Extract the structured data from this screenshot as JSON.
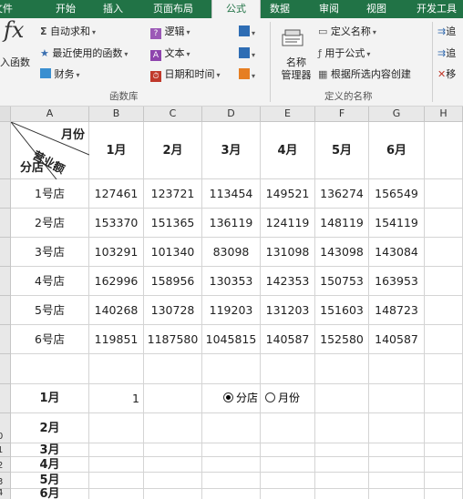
{
  "tabs": [
    {
      "label": "文件",
      "active": false
    },
    {
      "label": "开始",
      "active": false
    },
    {
      "label": "插入",
      "active": false
    },
    {
      "label": "页面布局",
      "active": false
    },
    {
      "label": "公式",
      "active": true
    },
    {
      "label": "数据",
      "active": false
    },
    {
      "label": "审阅",
      "active": false
    },
    {
      "label": "视图",
      "active": false
    },
    {
      "label": "开发工具",
      "active": false
    }
  ],
  "ribbon": {
    "insert_fn": "入函数",
    "fx": "fx",
    "autosum": "自动求和",
    "recent": "最近使用的函数",
    "finance": "财务",
    "logic": "逻辑",
    "text": "文本",
    "datetime": "日期和时间",
    "group_lib": "函数库",
    "name_mgr_1": "名称",
    "name_mgr_2": "管理器",
    "define_name": "定义名称",
    "use_in_formula": "用于公式",
    "create_from_sel": "根据所选内容创建",
    "group_names": "定义的名称",
    "right1": "追",
    "right2": "追",
    "right3": "移"
  },
  "columns": [
    "A",
    "B",
    "C",
    "D",
    "E",
    "F",
    "G",
    "H"
  ],
  "header_cell": {
    "top": "月份",
    "mid": "营业额",
    "bottom": "分店"
  },
  "months": [
    "1月",
    "2月",
    "3月",
    "4月",
    "5月",
    "6月"
  ],
  "stores": [
    {
      "name": "1号店",
      "values": [
        "127461",
        "123721",
        "113454",
        "149521",
        "136274",
        "156549"
      ]
    },
    {
      "name": "2号店",
      "values": [
        "153370",
        "151365",
        "136119",
        "124119",
        "148119",
        "154119"
      ]
    },
    {
      "name": "3号店",
      "values": [
        "103291",
        "101340",
        "83098",
        "131098",
        "143098",
        "143084"
      ]
    },
    {
      "name": "4号店",
      "values": [
        "162996",
        "158956",
        "130353",
        "142353",
        "150753",
        "163953"
      ]
    },
    {
      "name": "5号店",
      "values": [
        "140268",
        "130728",
        "119203",
        "131203",
        "151603",
        "148723"
      ]
    },
    {
      "name": "6号店",
      "values": [
        "119851",
        "1187580",
        "1045815",
        "140587",
        "152580",
        "140587"
      ]
    }
  ],
  "selector": {
    "value": "1",
    "radio_store": "分店",
    "radio_month": "月份",
    "selected": "store"
  },
  "row_numbers": [
    "",
    "",
    "",
    "",
    "",
    "",
    "",
    "",
    "",
    "0",
    "1",
    "2",
    "3",
    "4",
    ""
  ]
}
